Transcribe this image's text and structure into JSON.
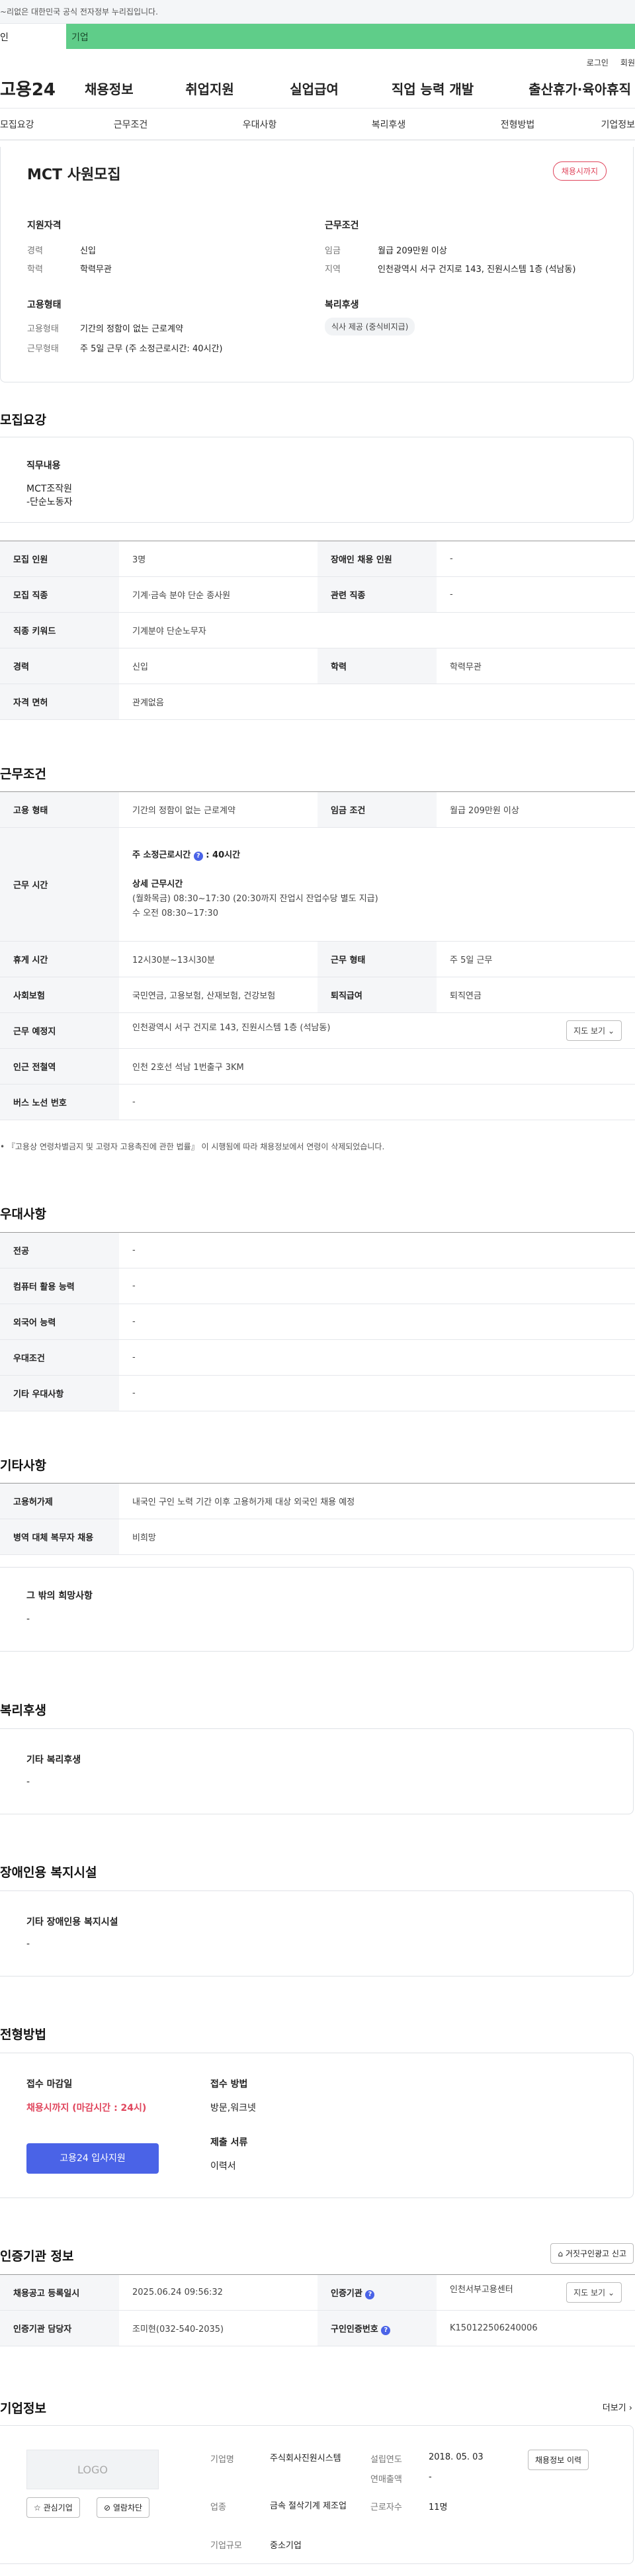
{
  "notice": "~리없은 대한민국 공식 전자정부 누리집입니다.",
  "usertype": {
    "personal": "인",
    "company": "기업"
  },
  "util": {
    "login": "로그인",
    "join": "회원"
  },
  "gnb": {
    "logo": "고용24",
    "items": [
      "채용정보",
      "취업지원",
      "실업급여",
      "직업 능력 개발",
      "출산휴가·육아휴직"
    ]
  },
  "tabs": [
    "모집요강",
    "근무조건",
    "우대사항",
    "복리후생",
    "전형방법",
    "기업정보"
  ],
  "summary": {
    "title": "MCT 사원모집",
    "badge": "채용시까지",
    "qual_title": "지원자격",
    "career_label": "경력",
    "career": "신입",
    "edu_label": "학력",
    "edu": "학력무관",
    "cond_title": "근무조건",
    "wage_label": "임금",
    "wage": "월급 209만원 이상",
    "area_label": "지역",
    "area": "인천광역시 서구 건지로 143, 진원시스템 1층 (석남동)",
    "emp_title": "고용형태",
    "emp_label": "고용형태",
    "emp": "기간의 정함이 없는 근로계약",
    "work_label": "근무형태",
    "work": "주 5일 근무 (주 소정근로시간: 40시간)",
    "welfare_title": "복리후생",
    "welfare_tag": "식사 제공 (중식비지급)"
  },
  "recruit": {
    "title": "모집요강",
    "duty_title": "직무내용",
    "duty_lines": [
      "MCT조작원",
      "-단순노동자"
    ],
    "rows": [
      [
        "모집 인원",
        "3명",
        "장애인 채용 인원",
        "-"
      ],
      [
        "모집 직종",
        "기계·금속 분야 단순 종사원",
        "관련 직종",
        "-"
      ],
      [
        "직종 키워드",
        "기계분야 단순노무자",
        "",
        ""
      ],
      [
        "경력",
        "신입",
        "학력",
        "학력무관"
      ],
      [
        "자격 면허",
        "관계없음",
        "",
        ""
      ]
    ]
  },
  "cond": {
    "title": "근무조건",
    "emp_h": "고용 형태",
    "emp_v": "기간의 정함이 없는 근로계약",
    "wage_h": "임금 조건",
    "wage_v": "월급 209만원 이상",
    "time_h": "근무 시간",
    "time_main": "주 소정근로시간",
    "time_hours": "40시간",
    "time_detail_title": "상세 근무시간",
    "time_detail1": "(월화목금) 08:30~17:30 (20:30까지 잔업시 잔업수당 별도 지급)",
    "time_detail2": "수 오전 08:30~17:30",
    "rest_h": "휴게 시간",
    "rest_v": "12시30분~13시30분",
    "type_h": "근무 형태",
    "type_v": "주 5일 근무",
    "ins_h": "사회보험",
    "ins_v": "국민연금, 고용보험, 산재보험, 건강보험",
    "ret_h": "퇴직급여",
    "ret_v": "퇴직연금",
    "place_h": "근무 예정지",
    "place_v": "인천광역시 서구 건지로 143, 진원시스템 1층 (석남동)",
    "map_btn": "지도 보기",
    "sub_h": "인근 전철역",
    "sub_v": "인천 2호선 석남 1번출구 3KM",
    "bus_h": "버스 노선 번호",
    "bus_v": "-",
    "note": "• 『고용상 연령차별금지 및 고령자 고용촉진에 관한 법률』 이 시행됨에 따라 채용정보에서 연령이 삭제되었습니다."
  },
  "pref": {
    "title": "우대사항",
    "rows": [
      [
        "전공",
        "-"
      ],
      [
        "컴퓨터 활용 능력",
        "-"
      ],
      [
        "외국어 능력",
        "-"
      ],
      [
        "우대조건",
        "-"
      ],
      [
        "기타 우대사항",
        "-"
      ]
    ]
  },
  "etc": {
    "title": "기타사항",
    "rows": [
      [
        "고용허가제",
        "내국인 구인 노력 기간 이후 고용허가제 대상 외국인 채용 예정"
      ],
      [
        "병역 대체 복무자 채용",
        "비희망"
      ]
    ],
    "hope_title": "그 밖의 희망사항",
    "hope_v": "-"
  },
  "welfare": {
    "title": "복리후생",
    "box_title": "기타 복리후생",
    "box_v": "-"
  },
  "disabled": {
    "title": "장애인용 복지시설",
    "box_title": "기타 장애인용 복지시설",
    "box_v": "-"
  },
  "select": {
    "title": "전형방법",
    "deadline_title": "접수 마감일",
    "deadline_v": "채용시까지 (마감시간 : 24시)",
    "apply_btn": "고용24 입사지원",
    "method_title": "접수 방법",
    "method_v": "방문,워크넷",
    "docs_title": "제출 서류",
    "docs_v": "이력서"
  },
  "agency": {
    "title": "인증기관 정보",
    "report_btn": "거짓구인광고 신고",
    "r1": [
      "채용공고 등록일시",
      "2025.06.24 09:56:32",
      "인증기관",
      "인천서부고용센터"
    ],
    "r2": [
      "인증기관 담당자",
      "조미현(032-540-2035)",
      "구인인증번호",
      "K150122506240006"
    ],
    "map_btn": "지도 보기"
  },
  "company": {
    "title": "기업정보",
    "more": "더보기",
    "logo": "LOGO",
    "fav_btn": "관심기업",
    "block_btn": "열람차단",
    "name_h": "기업명",
    "name_v": "주식회사진원시스템",
    "year_h": "설립연도",
    "year_v": "2018. 05. 03",
    "hist_btn": "채용정보 이력",
    "sales_h": "연매출액",
    "sales_v": "-",
    "ind_h": "업종",
    "ind_v": "금속 절삭기계 제조업",
    "emp_h": "근로자수",
    "emp_v": "11명",
    "size_h": "기업규모",
    "size_v": "중소기업"
  }
}
